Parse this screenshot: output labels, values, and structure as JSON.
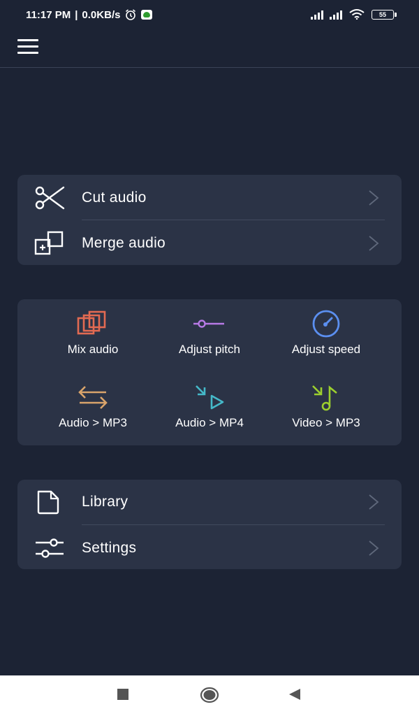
{
  "status_bar": {
    "time": "11:17 PM",
    "separator": "|",
    "speed": "0.0KB/s",
    "battery": "55"
  },
  "menu_card": {
    "items": [
      {
        "label": "Cut audio",
        "icon": "scissors-icon"
      },
      {
        "label": "Merge audio",
        "icon": "merge-icon"
      }
    ]
  },
  "tools_card": {
    "tools": [
      {
        "label": "Mix audio",
        "icon": "mix-icon",
        "color": "#e26a52"
      },
      {
        "label": "Adjust pitch",
        "icon": "pitch-icon",
        "color": "#b77ae6"
      },
      {
        "label": "Adjust speed",
        "icon": "speedometer-icon",
        "color": "#5b8ff0"
      },
      {
        "label": "Audio > MP3",
        "icon": "swap-arrows-icon",
        "color": "#d9a46b"
      },
      {
        "label": "Audio > MP4",
        "icon": "video-convert-icon",
        "color": "#45b9c9"
      },
      {
        "label": "Video > MP3",
        "icon": "music-convert-icon",
        "color": "#9ccf2e"
      }
    ]
  },
  "bottom_card": {
    "items": [
      {
        "label": "Library",
        "icon": "file-icon"
      },
      {
        "label": "Settings",
        "icon": "sliders-icon"
      }
    ]
  },
  "colors": {
    "background": "#1c2334",
    "card": "#2b3346",
    "divider": "#414a5e"
  }
}
